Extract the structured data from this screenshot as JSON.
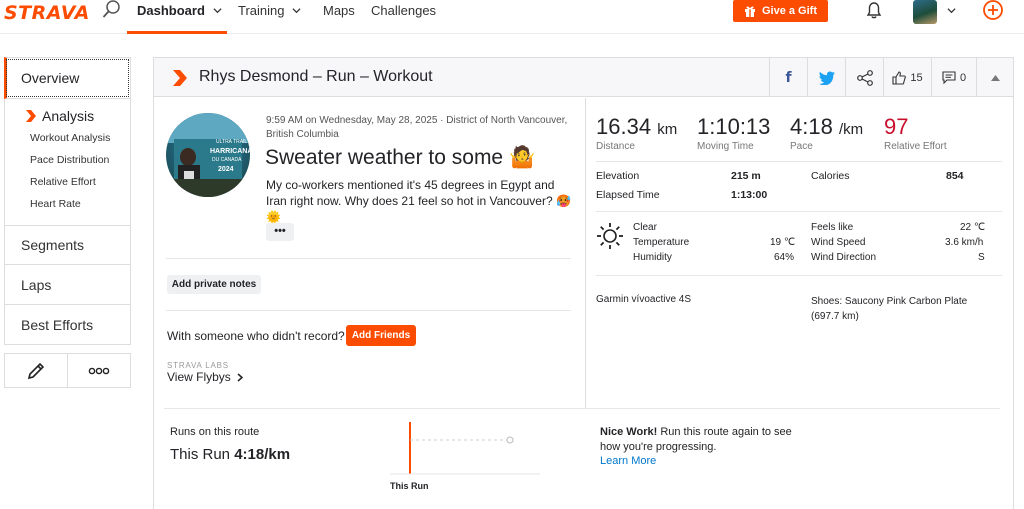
{
  "brand": {
    "logo": "STRAVA",
    "accent": "#fc4c02"
  },
  "nav": {
    "items": [
      {
        "label": "Dashboard",
        "active": true
      },
      {
        "label": "Training"
      },
      {
        "label": "Maps"
      },
      {
        "label": "Challenges"
      }
    ],
    "gift_label": "Give a Gift"
  },
  "sidebar": {
    "overview": "Overview",
    "analysis": "Analysis",
    "analysis_links": [
      "Workout Analysis",
      "Pace Distribution",
      "Relative Effort",
      "Heart Rate"
    ],
    "sections": [
      "Segments",
      "Laps",
      "Best Efforts"
    ]
  },
  "activity": {
    "header_title": "Rhys Desmond – Run – Workout",
    "kudos": "15",
    "comments": "0",
    "meta_line": "9:59 AM on Wednesday, May 28, 2025 · District of North Vancouver, British Columbia",
    "title": "Sweater weather to some 🤷",
    "description": "My co-workers mentioned it's 45 degrees in Egypt and Iran right now. Why does 21 feel so hot in Vancouver? 🥵 🌞",
    "more_label": "•••",
    "private_notes_label": "Add private notes",
    "someone_label": "With someone who didn't record?",
    "add_friends_label": "Add Friends",
    "labs_label": "STRAVA LABS",
    "flybys_label": "View Flybys"
  },
  "stats": {
    "distance": {
      "value": "16.34",
      "unit": "km",
      "label": "Distance"
    },
    "moving_time": {
      "value": "1:10:13",
      "label": "Moving Time"
    },
    "pace": {
      "value": "4:18",
      "unit": "/km",
      "label": "Pace"
    },
    "relative_effort": {
      "value": "97",
      "label": "Relative Effort",
      "color": "#c8102e"
    },
    "elevation": {
      "label": "Elevation",
      "value": "215 m"
    },
    "calories": {
      "label": "Calories",
      "value": "854"
    },
    "elapsed_time": {
      "label": "Elapsed Time",
      "value": "1:13:00"
    }
  },
  "weather": {
    "condition": "Clear",
    "temperature_label": "Temperature",
    "temperature": "19 ℃",
    "humidity_label": "Humidity",
    "humidity": "64%",
    "feels_like_label": "Feels like",
    "feels_like": "22 ℃",
    "wind_speed_label": "Wind Speed",
    "wind_speed": "3.6 km/h",
    "wind_direction_label": "Wind Direction",
    "wind_direction": "S"
  },
  "gear": {
    "device": "Garmin vívoactive 4S",
    "shoes": "Shoes: Saucony Pink Carbon Plate (697.7 km)"
  },
  "route": {
    "runs_label": "Runs on this route",
    "this_run_prefix": "This Run",
    "this_run_pace": "4:18/km",
    "chart_label": "This Run",
    "nice_bold": "Nice Work!",
    "nice_text": " Run this route again to see how you're progressing.",
    "learn_more": "Learn More"
  }
}
